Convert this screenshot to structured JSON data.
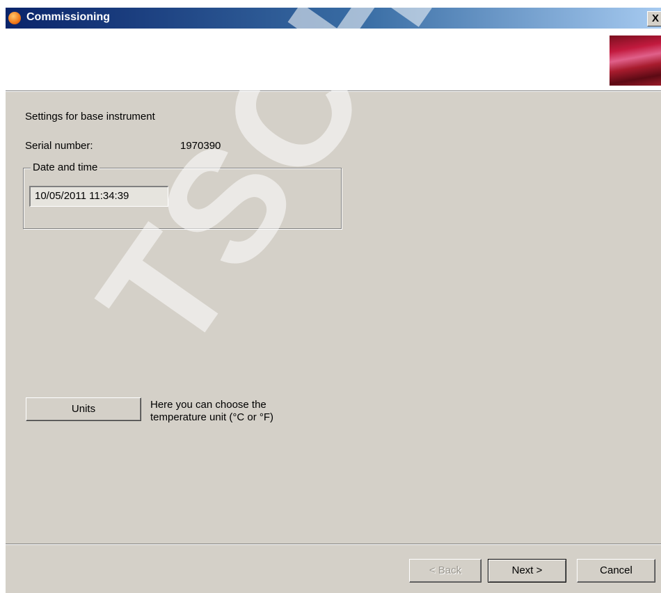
{
  "window": {
    "title": "Commissioning",
    "close_symbol": "X",
    "app_icon": "testo-logo-icon"
  },
  "content": {
    "section_title": "Settings for base instrument",
    "serial_label": "Serial number:",
    "serial_value": "1970390",
    "datetime_group_label": "Date and time",
    "datetime_value": "10/05/2011 11:34:39",
    "units_button": "Units",
    "units_hint": "Here you can choose the temperature unit (°C or °F)"
  },
  "footer": {
    "back_label": "< Back",
    "next_label": "Next >",
    "cancel_label": "Cancel"
  },
  "watermark": {
    "text": "TSCHER SA"
  },
  "colors": {
    "dialog_bg": "#d4d0c8",
    "titlebar_start": "#0a246a",
    "titlebar_end": "#a6caf0",
    "header_bg": "#ffffff"
  }
}
